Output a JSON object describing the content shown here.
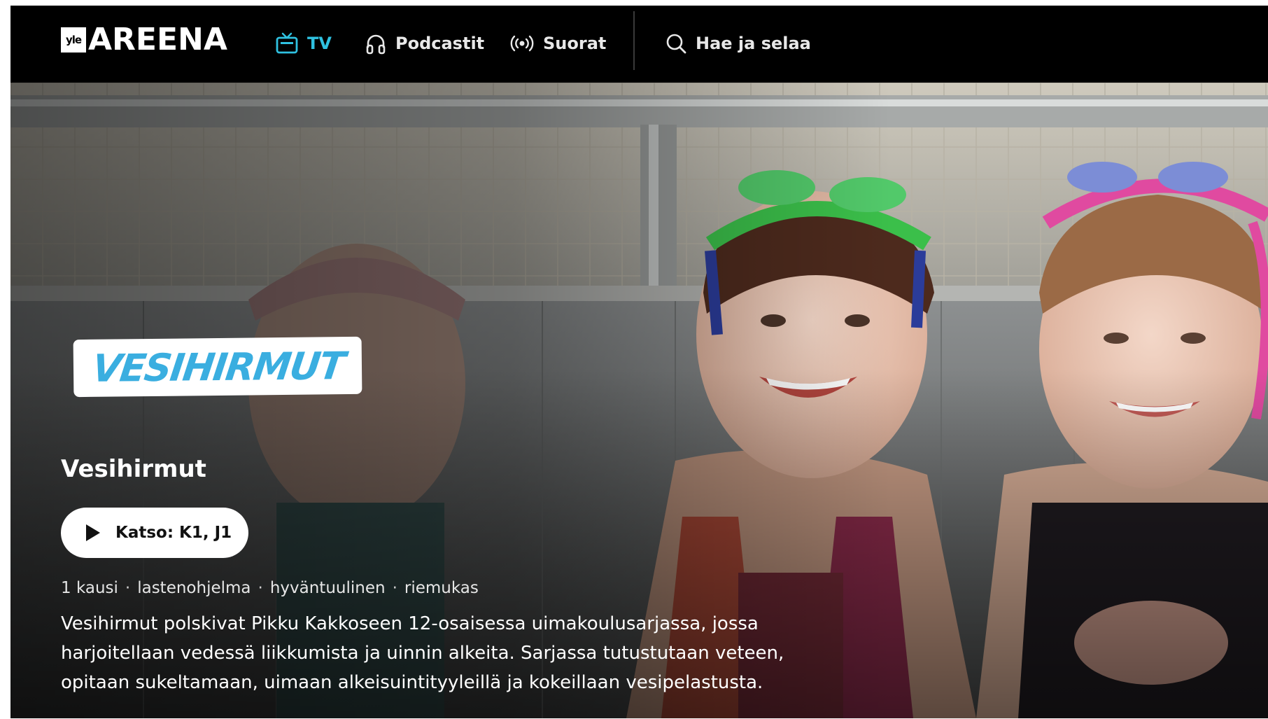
{
  "nav": {
    "logo_badge": "yle",
    "logo_word": "AREENA",
    "items": [
      {
        "label": "TV",
        "icon": "tv-icon",
        "active": true
      },
      {
        "label": "Podcastit",
        "icon": "headphones-icon",
        "active": false
      },
      {
        "label": "Suorat",
        "icon": "broadcast-icon",
        "active": false
      }
    ],
    "search_label": "Hae ja selaa"
  },
  "hero": {
    "show_logo_text": "VESIHIRMUT",
    "title": "Vesihirmut",
    "watch_label": "Katso: K1, J1",
    "meta": [
      "1 kausi",
      "lastenohjelma",
      "hyväntuulinen",
      "riemukas"
    ],
    "description": "Vesihirmut polskivat Pikku Kakkoseen 12-osaisessa uimakoulusarjassa, jossa harjoitellaan vedessä liikkumista ja uinnin alkeita. Sarjassa tutustutaan veteen, opitaan sukeltamaan, uimaan alkeisuintityyleillä ja kokeillaan vesipelastusta."
  },
  "colors": {
    "accent": "#2fc1e0",
    "logo_blue": "#3aaee0",
    "background": "#000000"
  }
}
